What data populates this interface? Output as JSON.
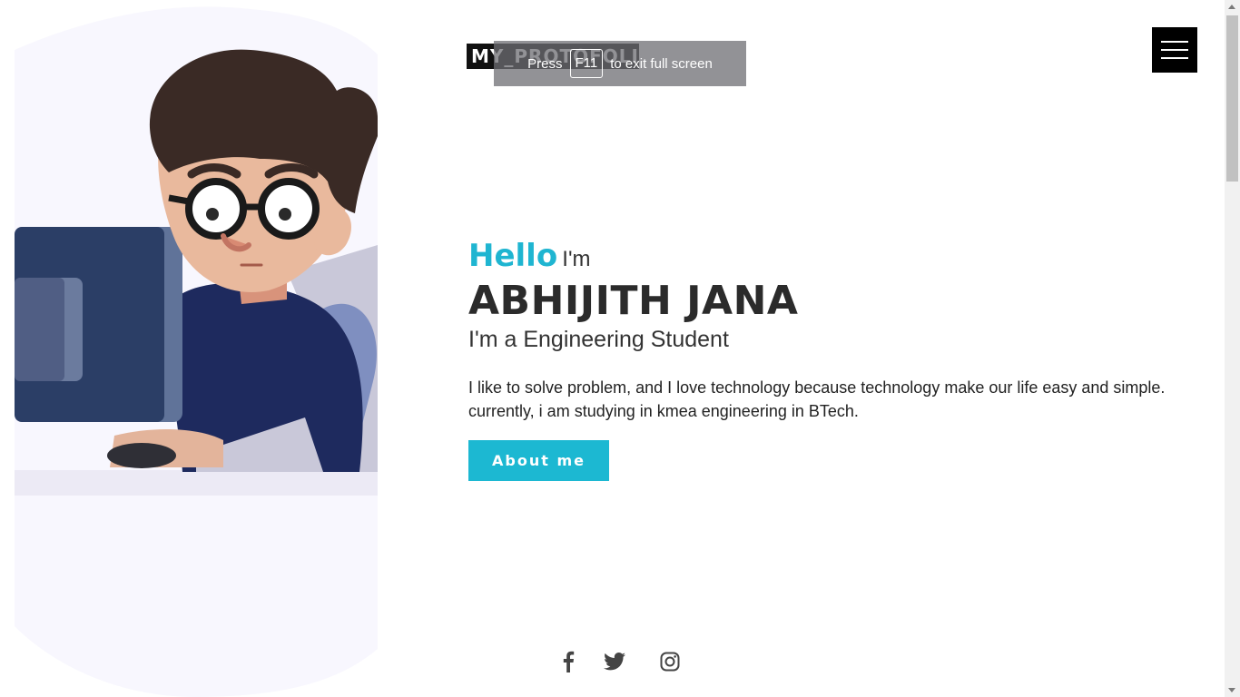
{
  "logo": {
    "text": "MY_PROTOFOLIO"
  },
  "fullscreen_notice": {
    "before": "Press",
    "key": "F11",
    "after": "to exit full screen"
  },
  "menu": {
    "icon": "hamburger-menu-icon"
  },
  "hero": {
    "hello": "Hello",
    "im": "I'm",
    "name": "ABHIJITH JANA",
    "role": "I'm a Engineering Student",
    "description": "I like to solve problem, and I love technology because technology make our life easy and simple. currently, i am studying in kmea engineering in BTech.",
    "button_label": "About me"
  },
  "social_icons": [
    "facebook-icon",
    "twitter-icon",
    "instagram-icon"
  ],
  "colors": {
    "accent": "#1fb5d1",
    "button": "#1cb8d2",
    "text_dark": "#2b2b2b",
    "menu_bg": "#000000"
  }
}
